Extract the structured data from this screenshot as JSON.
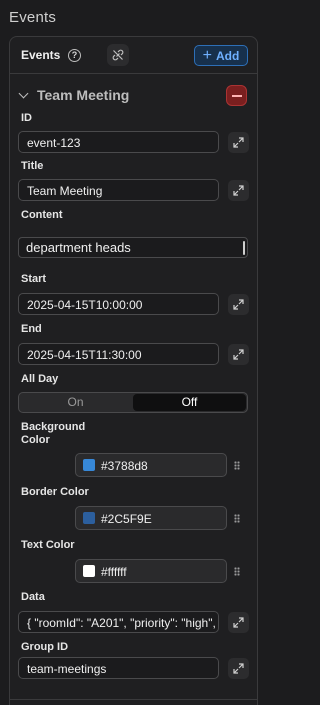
{
  "section": {
    "title": "Events"
  },
  "panel": {
    "label": "Events",
    "help_icon": "?",
    "add_label": "Add"
  },
  "item": {
    "title": "Team Meeting",
    "fields": {
      "id": {
        "label": "ID",
        "value": "event-123"
      },
      "title": {
        "label": "Title",
        "value": "Team Meeting"
      },
      "content": {
        "label": "Content",
        "value": "department heads"
      },
      "start": {
        "label": "Start",
        "value": "2025-04-15T10:00:00"
      },
      "end": {
        "label": "End",
        "value": "2025-04-15T11:30:00"
      },
      "all_day": {
        "label": "All Day",
        "options": [
          "On",
          "Off"
        ],
        "selected": "Off"
      },
      "background_color": {
        "label_line1": "Background",
        "label_line2": "Color",
        "value": "#3788d8",
        "swatch": "#3788d8"
      },
      "border_color": {
        "label": "Border Color",
        "value": "#2C5F9E",
        "swatch": "#2C5F9E"
      },
      "text_color": {
        "label": "Text Color",
        "value": "#ffffff",
        "swatch": "#ffffff"
      },
      "data": {
        "label": "Data",
        "value": "{ \"roomId\": \"A201\", \"priority\": \"high\", "
      },
      "group_id": {
        "label": "Group ID",
        "value": "team-meetings"
      }
    }
  },
  "colors": {
    "accent": "#2d6fb7",
    "danger": "#7a1f1f",
    "background": "#1c1c1e"
  }
}
